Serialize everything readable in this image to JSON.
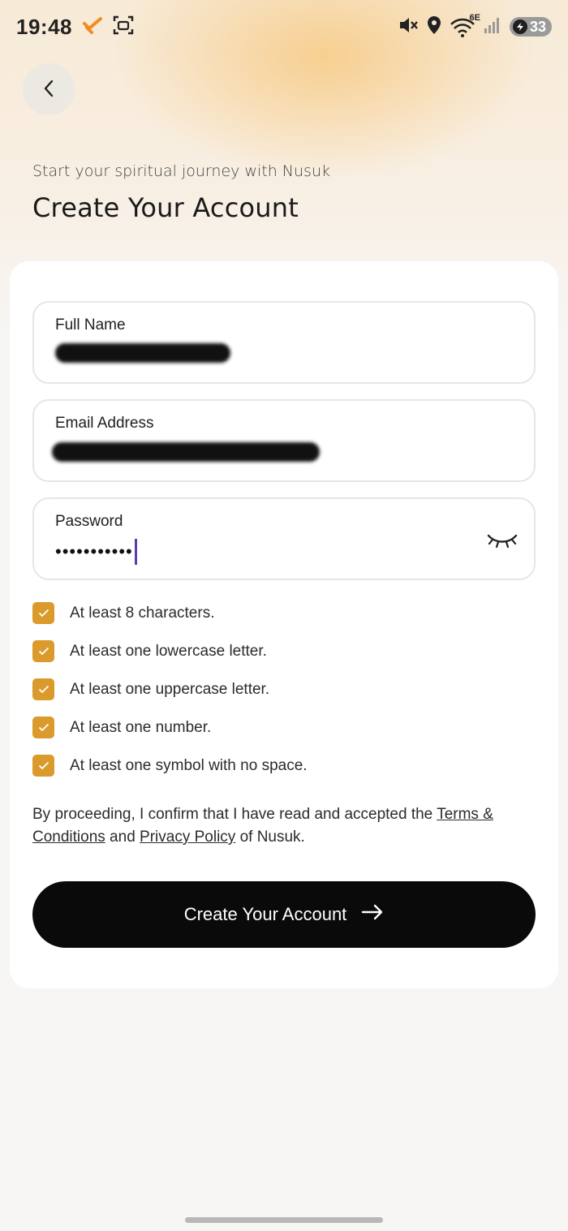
{
  "status_bar": {
    "time": "19:48",
    "battery": "33",
    "network": "6E"
  },
  "header": {
    "subtitle": "Start your spiritual journey with Nusuk",
    "title": "Create Your Account"
  },
  "form": {
    "full_name": {
      "label": "Full Name",
      "value": ""
    },
    "email": {
      "label": "Email Address",
      "value": ""
    },
    "password": {
      "label": "Password",
      "masked_value": "•••••••••••"
    }
  },
  "password_rules": [
    {
      "text": "At least 8 characters.",
      "checked": true
    },
    {
      "text": "At least one lowercase letter.",
      "checked": true
    },
    {
      "text": "At least one uppercase letter.",
      "checked": true
    },
    {
      "text": "At least one number.",
      "checked": true
    },
    {
      "text": "At least one symbol with no space.",
      "checked": true
    }
  ],
  "consent": {
    "prefix": "By proceeding, I confirm that I have read and accepted the ",
    "terms_link": "Terms & Conditions",
    "middle": " and ",
    "privacy_link": "Privacy Policy",
    "suffix": " of Nusuk."
  },
  "cta": {
    "label": "Create Your Account"
  },
  "colors": {
    "accent": "#db9a2c",
    "cta_background": "#0a0a0a",
    "caret": "#5a3fa8"
  }
}
